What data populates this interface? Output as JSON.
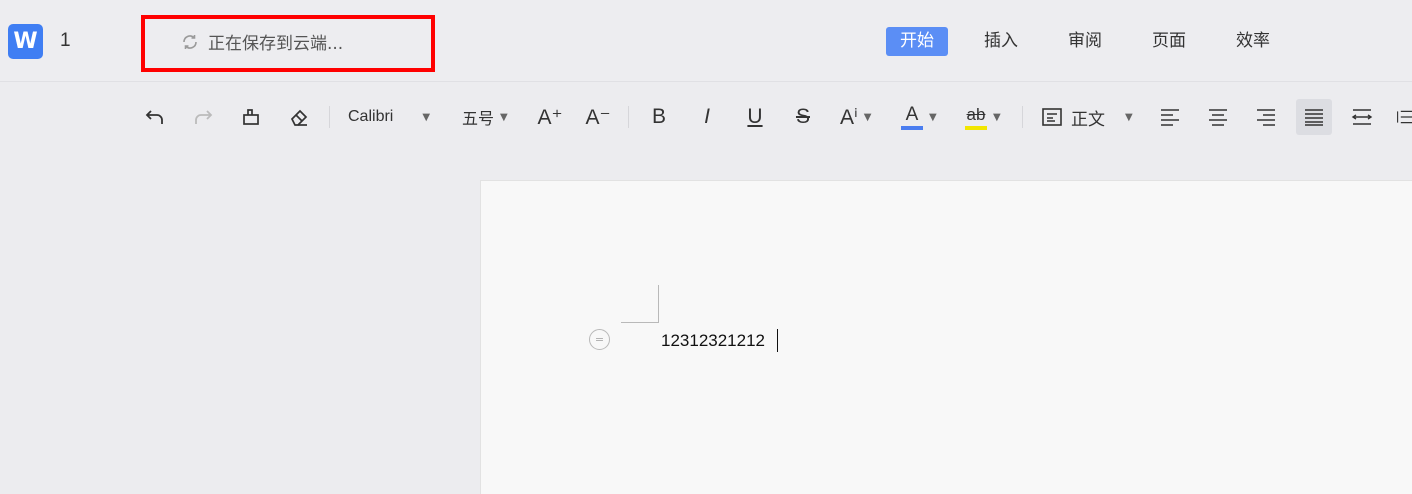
{
  "app": {
    "logo_letter": "W",
    "doc_title": "1"
  },
  "save_status": {
    "text": "正在保存到云端...",
    "highlight_color": "#ff0000"
  },
  "tabs": [
    {
      "label": "开始",
      "active": true
    },
    {
      "label": "插入",
      "active": false
    },
    {
      "label": "审阅",
      "active": false
    },
    {
      "label": "页面",
      "active": false
    },
    {
      "label": "效率",
      "active": false
    }
  ],
  "toolbar": {
    "font_name": "Calibri",
    "font_size": "五号",
    "increase_font_label": "A⁺",
    "decrease_font_label": "A⁻",
    "bold_label": "B",
    "italic_label": "I",
    "underline_label": "U",
    "strike_label": "S",
    "text_effect_label": "Aⁱ",
    "font_color_label": "A",
    "font_color": "#4a7df0",
    "highlight_label": "ab",
    "highlight_color": "#f2e600",
    "style_name": "正文"
  },
  "document": {
    "text": "12312321212"
  },
  "colors": {
    "accent": "#5b8ef5",
    "logo": "#3f7ef3"
  }
}
